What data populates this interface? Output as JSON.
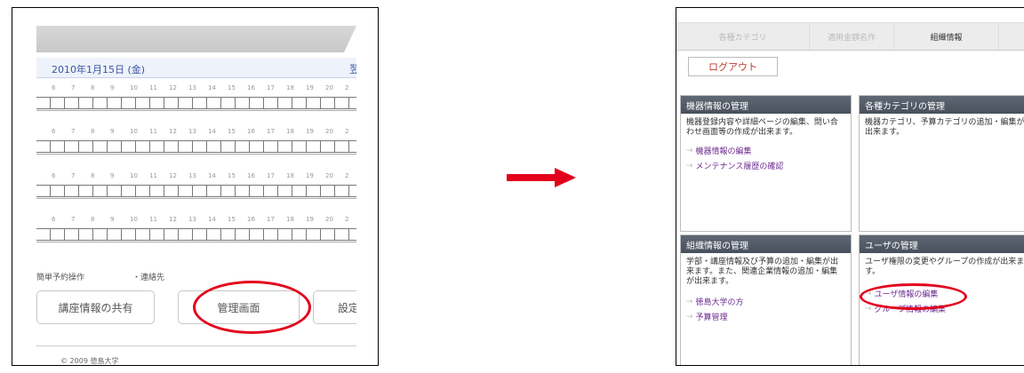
{
  "left": {
    "date": "2010年1月15日 (金)",
    "next": "翌",
    "hours": [
      "6",
      "7",
      "8",
      "9",
      "10",
      "11",
      "12",
      "13",
      "14",
      "15",
      "16",
      "17",
      "18",
      "19",
      "20",
      "2"
    ],
    "footer_label1": "簡単予約操作",
    "footer_label2": "・連絡先",
    "btn_share": "講座情報の共有",
    "btn_admin": "管理画面",
    "btn_settings": "設定",
    "copyright": "© 2009 徳島大学"
  },
  "right": {
    "nav": [
      "各種カテゴリ",
      "適用金額名作",
      "組織情報"
    ],
    "logout": "ログアウト",
    "cards": [
      {
        "title": "機器情報の管理",
        "desc": "機器登録内容や詳細ページの編集、問い合わせ画面等の作成が出来ます。",
        "links": [
          "機器情報の編集",
          "メンテナンス履歴の確認"
        ]
      },
      {
        "title": "各種カテゴリの管理",
        "desc": "機器カテゴリ、予算カテゴリの追加・編集が出来ます。",
        "links": []
      },
      {
        "title": "組織情報の管理",
        "desc": "学部・講座情報及び予算の追加・編集が出来ます。また、関連企業情報の追加・編集が出来ます。",
        "links": [
          "徳島大学の方",
          "予算管理"
        ]
      },
      {
        "title": "ユーザの管理",
        "desc": "ユーザ権限の変更やグループの作成が出来ます。",
        "links": [
          "ユーザ情報の編集",
          "グループ情報の編集"
        ]
      }
    ]
  },
  "colors": {
    "accent_red": "#e3001b",
    "header_dark": "#525a66",
    "link_purple": "#6b2a8f"
  }
}
